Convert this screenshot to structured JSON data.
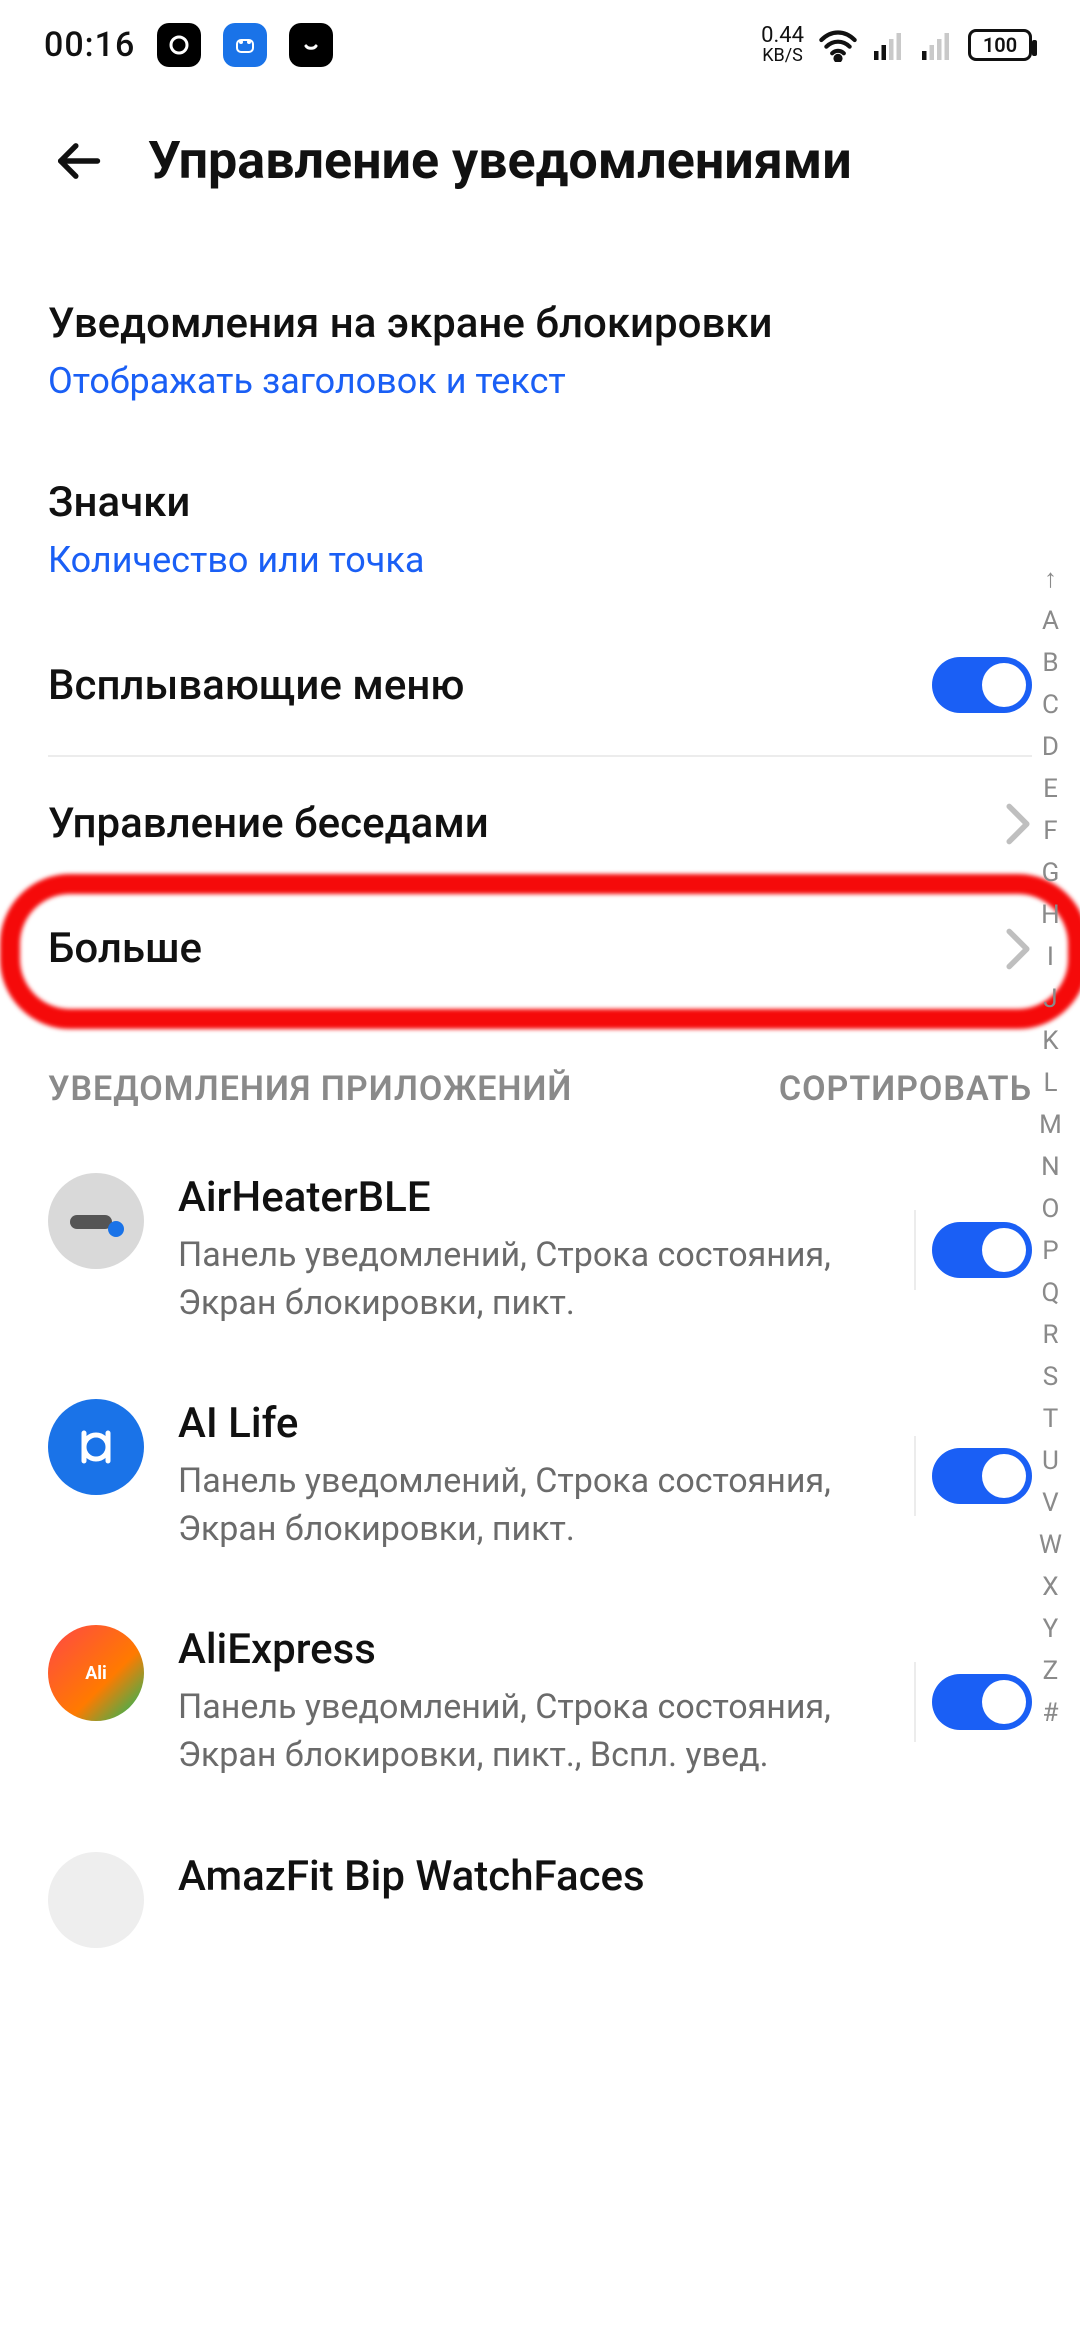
{
  "statusbar": {
    "time": "00:16",
    "net_speed_val": "0.44",
    "net_speed_unit": "KB/S",
    "battery": "100"
  },
  "header": {
    "title": "Управление уведомлениями"
  },
  "rows": {
    "lockscreen": {
      "label": "Уведомления на экране блокировки",
      "sub": "Отображать заголовок и текст"
    },
    "badges": {
      "label": "Значки",
      "sub": "Количество или точка"
    },
    "popup": {
      "label": "Всплывающие меню"
    },
    "conversations": {
      "label": "Управление беседами"
    },
    "more": {
      "label": "Больше"
    }
  },
  "section": {
    "title": "УВЕДОМЛЕНИЯ ПРИЛОЖЕНИЙ",
    "sort": "СОРТИРОВАТЬ"
  },
  "apps": [
    {
      "name": "AirHeaterBLE",
      "desc": "Панель уведомлений, Строка состояния, Экран блокировки, пикт.",
      "bg": "#d9d9d9"
    },
    {
      "name": "AI Life",
      "desc": "Панель уведомлений, Строка состояния, Экран блокировки, пикт.",
      "bg": "#1a73e8"
    },
    {
      "name": "AliExpress",
      "desc": "Панель уведомлений, Строка состояния, Экран блокировки, пикт., Вспл. увед.",
      "bg": "#ff4747"
    },
    {
      "name": "AmazFit Bip WatchFaces",
      "desc": "",
      "bg": "#888"
    }
  ],
  "index": [
    "↑",
    "A",
    "B",
    "C",
    "D",
    "E",
    "F",
    "G",
    "H",
    "I",
    "J",
    "K",
    "L",
    "M",
    "N",
    "O",
    "P",
    "Q",
    "R",
    "S",
    "T",
    "U",
    "V",
    "W",
    "X",
    "Y",
    "Z",
    "#"
  ]
}
